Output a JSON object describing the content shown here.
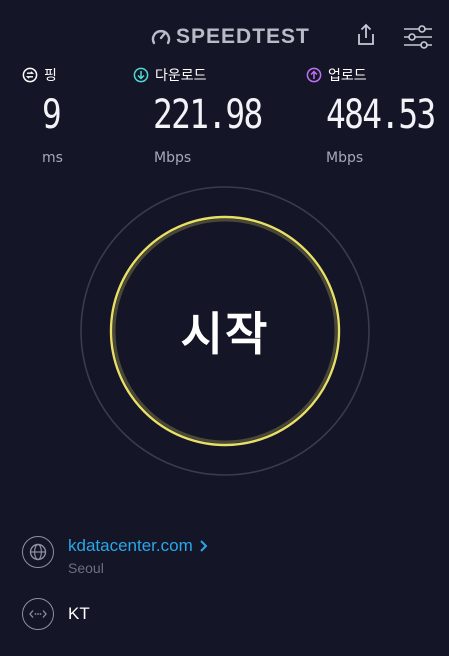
{
  "header": {
    "logo_text": "SPEEDTEST",
    "share_icon": "share-icon",
    "settings_icon": "settings-sliders-icon"
  },
  "metrics": {
    "ping": {
      "label": "핑",
      "value": "9",
      "unit": "ms",
      "icon": "ping-icon",
      "color": "#ffffff"
    },
    "download": {
      "label": "다운로드",
      "value": "221.98",
      "unit": "Mbps",
      "icon": "download-arrow-icon",
      "color": "#4fd8d5"
    },
    "upload": {
      "label": "업로드",
      "value": "484.53",
      "unit": "Mbps",
      "icon": "upload-arrow-icon",
      "color": "#bf71f5"
    }
  },
  "start": {
    "label": "시작",
    "ring_color": "#e8e066"
  },
  "server": {
    "name": "kdatacenter.com",
    "location": "Seoul",
    "icon": "globe-icon"
  },
  "isp": {
    "name": "KT",
    "icon": "network-dots-icon"
  }
}
